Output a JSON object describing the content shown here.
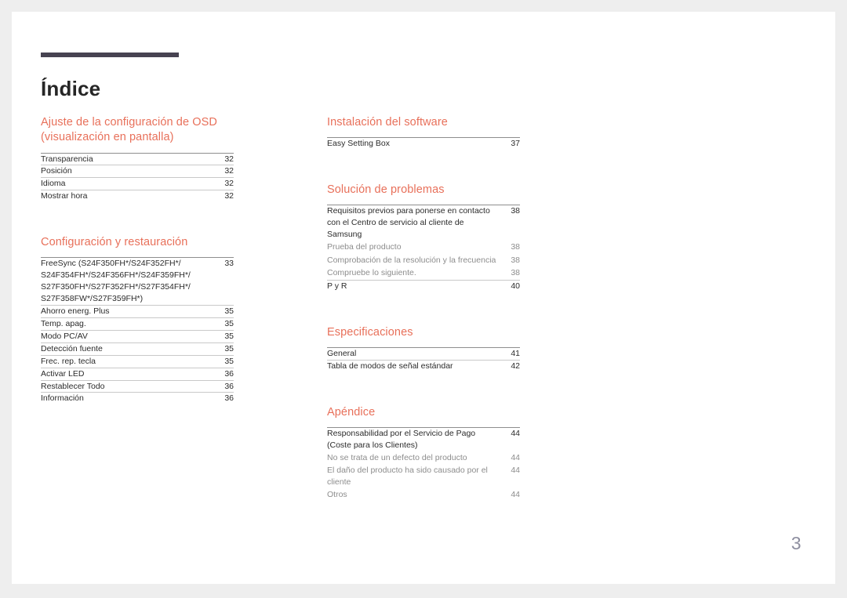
{
  "document": {
    "title": "Índice",
    "folio": "3",
    "accent_color": "#e8705a",
    "rule_color": "#474351",
    "folio_color": "#8e8fa0"
  },
  "left_column": [
    {
      "heading": "Ajuste de la configuración de OSD (visualización en pantalla)",
      "entries": [
        {
          "label": "Transparencia",
          "page": "32",
          "level": "main"
        },
        {
          "label": "Posición",
          "page": "32",
          "level": "main"
        },
        {
          "label": "Idioma",
          "page": "32",
          "level": "main"
        },
        {
          "label": "Mostrar hora",
          "page": "32",
          "level": "main"
        }
      ]
    },
    {
      "heading": "Configuración y restauración",
      "entries": [
        {
          "label": "FreeSync (S24F350FH*/S24F352FH*/\nS24F354FH*/S24F356FH*/S24F359FH*/\nS27F350FH*/S27F352FH*/S27F354FH*/\nS27F358FW*/S27F359FH*)",
          "page": "33",
          "level": "main"
        },
        {
          "label": "Ahorro energ. Plus",
          "page": "35",
          "level": "main"
        },
        {
          "label": "Temp. apag.",
          "page": "35",
          "level": "main"
        },
        {
          "label": "Modo PC/AV",
          "page": "35",
          "level": "main"
        },
        {
          "label": "Detección fuente",
          "page": "35",
          "level": "main"
        },
        {
          "label": "Frec. rep. tecla",
          "page": "35",
          "level": "main"
        },
        {
          "label": "Activar LED",
          "page": "36",
          "level": "main"
        },
        {
          "label": "Restablecer Todo",
          "page": "36",
          "level": "main"
        },
        {
          "label": "Información",
          "page": "36",
          "level": "main"
        }
      ]
    }
  ],
  "right_column": [
    {
      "heading": "Instalación del software",
      "entries": [
        {
          "label": "Easy Setting Box",
          "page": "37",
          "level": "main"
        }
      ]
    },
    {
      "heading": "Solución de problemas",
      "entries": [
        {
          "label": "Requisitos previos para ponerse en contacto\ncon el Centro de servicio al cliente de Samsung",
          "page": "38",
          "level": "main"
        },
        {
          "label": "Prueba del producto",
          "page": "38",
          "level": "sub"
        },
        {
          "label": "Comprobación de la resolución y la frecuencia",
          "page": "38",
          "level": "sub"
        },
        {
          "label": "Compruebe lo siguiente.",
          "page": "38",
          "level": "sub"
        },
        {
          "label": "P y R",
          "page": "40",
          "level": "main"
        }
      ]
    },
    {
      "heading": "Especificaciones",
      "entries": [
        {
          "label": "General",
          "page": "41",
          "level": "main"
        },
        {
          "label": "Tabla de modos de señal estándar",
          "page": "42",
          "level": "main"
        }
      ]
    },
    {
      "heading": "Apéndice",
      "entries": [
        {
          "label": "Responsabilidad por el Servicio de Pago\n(Coste para los Clientes)",
          "page": "44",
          "level": "main"
        },
        {
          "label": "No se trata de un defecto del producto",
          "page": "44",
          "level": "sub"
        },
        {
          "label": "El daño del producto ha sido causado por el\ncliente",
          "page": "44",
          "level": "sub"
        },
        {
          "label": "Otros",
          "page": "44",
          "level": "sub"
        }
      ]
    }
  ]
}
